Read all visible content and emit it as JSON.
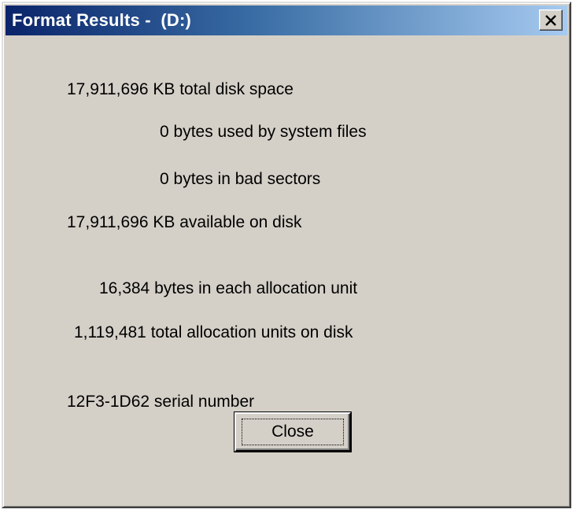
{
  "window": {
    "title": "Format Results -  (D:)"
  },
  "titlebar": {
    "close_icon": "close-x-icon"
  },
  "results": {
    "total_disk_space": "17,911,696 KB total disk space",
    "system_files": "0 bytes used by system files",
    "bad_sectors": "0 bytes in bad sectors",
    "available": "17,911,696 KB available on disk",
    "allocation_unit_size": "16,384 bytes in each allocation unit",
    "total_allocation_units": "1,119,481 total allocation units on disk",
    "serial_number": "12F3-1D62 serial number"
  },
  "buttons": {
    "close_label": "Close"
  },
  "colors": {
    "title_gradient_start": "#0a246a",
    "title_gradient_end": "#a6caf0",
    "dialog_face": "#d4d0c8"
  }
}
